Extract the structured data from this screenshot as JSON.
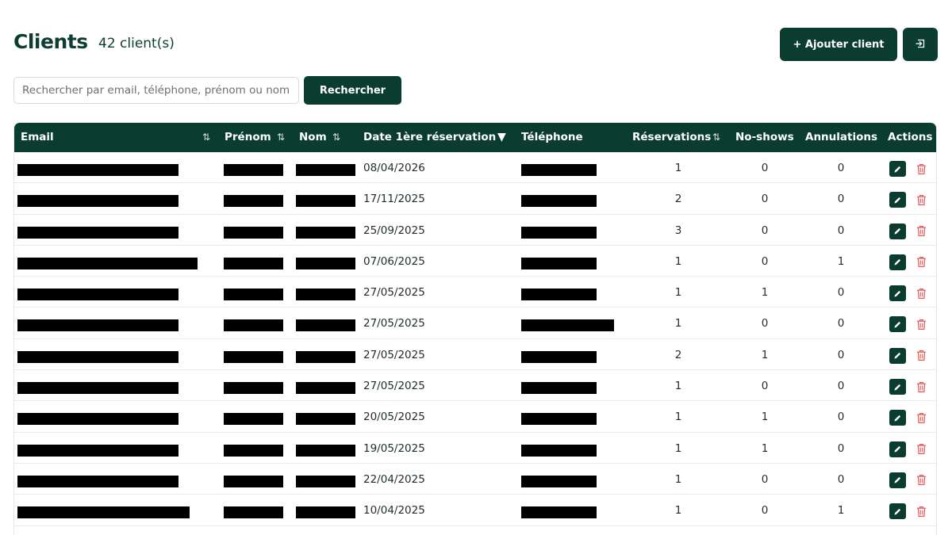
{
  "header": {
    "title": "Clients",
    "count": "42 client(s)",
    "add_label": "+ Ajouter client",
    "export_icon": "export-icon"
  },
  "search": {
    "placeholder": "Rechercher par email, téléphone, prénom ou nom...",
    "button_label": "Rechercher"
  },
  "table": {
    "columns": [
      {
        "label": "Email",
        "sortable": true
      },
      {
        "label": "Prénom",
        "sortable": true
      },
      {
        "label": "Nom",
        "sortable": true
      },
      {
        "label": "Date 1ère réservation",
        "sort": "desc"
      },
      {
        "label": "Téléphone"
      },
      {
        "label": "Réservations",
        "sortable": true
      },
      {
        "label": "No-shows"
      },
      {
        "label": "Annulations"
      },
      {
        "label": "Actions"
      }
    ],
    "rows": [
      {
        "date": "08/04/2026",
        "reservations": "1",
        "noshows": "0",
        "annulations": "0"
      },
      {
        "date": "17/11/2025",
        "reservations": "2",
        "noshows": "0",
        "annulations": "0"
      },
      {
        "date": "25/09/2025",
        "reservations": "3",
        "noshows": "0",
        "annulations": "0"
      },
      {
        "date": "07/06/2025",
        "reservations": "1",
        "noshows": "0",
        "annulations": "1"
      },
      {
        "date": "27/05/2025",
        "reservations": "1",
        "noshows": "1",
        "annulations": "0"
      },
      {
        "date": "27/05/2025",
        "reservations": "1",
        "noshows": "0",
        "annulations": "0"
      },
      {
        "date": "27/05/2025",
        "reservations": "2",
        "noshows": "1",
        "annulations": "0"
      },
      {
        "date": "27/05/2025",
        "reservations": "1",
        "noshows": "0",
        "annulations": "0"
      },
      {
        "date": "20/05/2025",
        "reservations": "1",
        "noshows": "1",
        "annulations": "0"
      },
      {
        "date": "19/05/2025",
        "reservations": "1",
        "noshows": "1",
        "annulations": "0"
      },
      {
        "date": "22/04/2025",
        "reservations": "1",
        "noshows": "0",
        "annulations": "0"
      },
      {
        "date": "10/04/2025",
        "reservations": "1",
        "noshows": "0",
        "annulations": "1"
      }
    ]
  },
  "colors": {
    "primary": "#0a3d30",
    "delete": "#e35b5b",
    "redaction": "#000000"
  }
}
